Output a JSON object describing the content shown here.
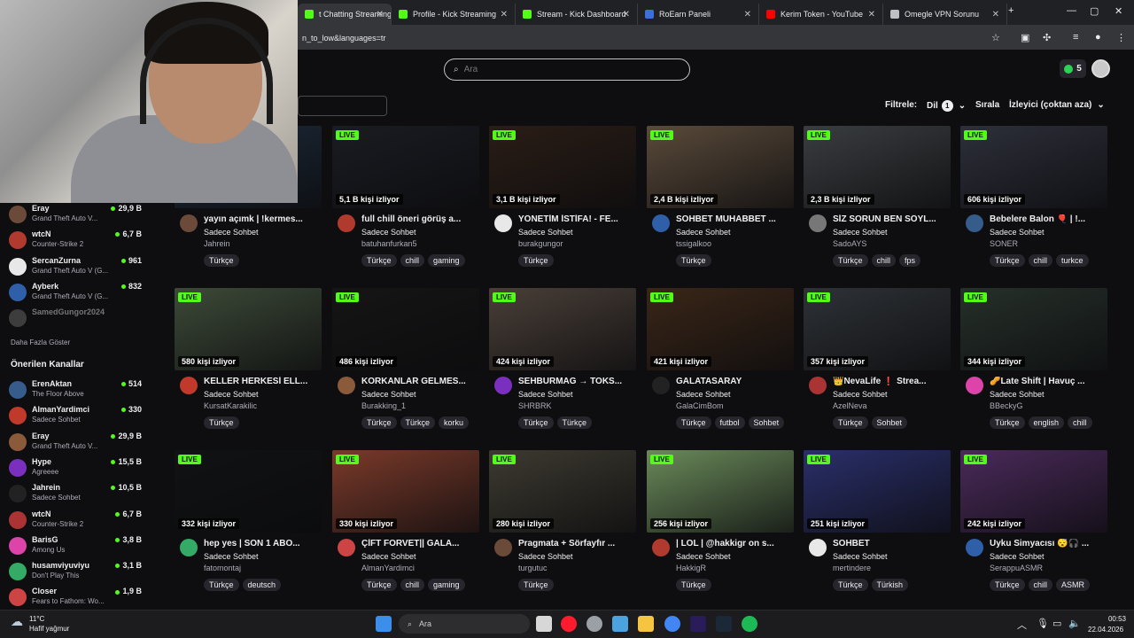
{
  "browser": {
    "tabs": [
      {
        "label": "t Chatting Streaming ·",
        "color": "#53fc18",
        "active": true
      },
      {
        "label": "Profile - Kick Streaming",
        "color": "#53fc18"
      },
      {
        "label": "Stream - Kick Dashboard",
        "color": "#53fc18"
      },
      {
        "label": "RoEarn Paneli",
        "color": "#3d6fd8"
      },
      {
        "label": "Kerim Token - YouTube",
        "color": "#ff0000"
      },
      {
        "label": "Omegle VPN Sorunu",
        "color": "#bdc1c6"
      }
    ],
    "url": "n_to_low&languages=tr"
  },
  "header": {
    "search_placeholder": "Ara",
    "coins": "5"
  },
  "filters": {
    "filter_label": "Filtrele:",
    "language_label": "Dil",
    "language_count": "1",
    "sort_label": "Sırala",
    "sort_value": "İzleyici (çoktan aza)"
  },
  "sidebar": {
    "followed": [
      {
        "name": "Eray",
        "game": "Grand Theft Auto V...",
        "viewers": "29,9 B"
      },
      {
        "name": "wtcN",
        "game": "Counter-Strike 2",
        "viewers": "6,7 B"
      },
      {
        "name": "SercanZurna",
        "game": "Grand Theft Auto V (G...",
        "viewers": "961"
      },
      {
        "name": "Ayberk",
        "game": "Grand Theft Auto V (G...",
        "viewers": "832"
      },
      {
        "name": "SamedGungor2024",
        "game": "",
        "viewers": ""
      }
    ],
    "show_more": "Daha Fazla Göster",
    "recommended_title": "Önerilen Kanallar",
    "recommended": [
      {
        "name": "ErenAktan",
        "game": "The Floor Above",
        "viewers": "514"
      },
      {
        "name": "AlmanYardimci",
        "game": "Sadece Sohbet",
        "viewers": "330"
      },
      {
        "name": "Eray",
        "game": "Grand Theft Auto V...",
        "viewers": "29,9 B"
      },
      {
        "name": "Hype",
        "game": "Agreeee",
        "viewers": "15,5 B"
      },
      {
        "name": "Jahrein",
        "game": "Sadece Sohbet",
        "viewers": "10,5 B"
      },
      {
        "name": "wtcN",
        "game": "Counter-Strike 2",
        "viewers": "6,7 B"
      },
      {
        "name": "BarisG",
        "game": "Among Us",
        "viewers": "3,8 B"
      },
      {
        "name": "husamviyuviyu",
        "game": "Don't Play This",
        "viewers": "3,1 B"
      },
      {
        "name": "Closer",
        "game": "Fears to Fathom: Wo...",
        "viewers": "1,9 B"
      }
    ]
  },
  "live_label": "LIVE",
  "streams": [
    {
      "viewers": "",
      "title": "yayın açımk | !kermes...",
      "category": "Sadece Sohbet",
      "channel": "Jahrein",
      "tags": [
        "Türkçe"
      ],
      "live": false,
      "color": "#1d2a3a"
    },
    {
      "viewers": "5,1 B kişi izliyor",
      "title": "full chill öneri görüş a...",
      "category": "Sadece Sohbet",
      "channel": "batuhanfurkan5",
      "tags": [
        "Türkçe",
        "chill",
        "gaming"
      ],
      "color": "#1a1c22"
    },
    {
      "viewers": "3,1 B kişi izliyor",
      "title": "YÖNETİM İSTİFA! - FE...",
      "category": "Sadece Sohbet",
      "channel": "burakgungor",
      "tags": [
        "Türkçe"
      ],
      "color": "#2a1d16"
    },
    {
      "viewers": "2,4 B kişi izliyor",
      "title": "SOHBET MUHABBET ...",
      "category": "Sadece Sohbet",
      "channel": "tssigalkoo",
      "tags": [
        "Türkçe"
      ],
      "color": "#5a4a3a"
    },
    {
      "viewers": "2,3 B kişi izliyor",
      "title": "SİZ SORUN BEN SÖYL...",
      "category": "Sadece Sohbet",
      "channel": "SadoAYS",
      "tags": [
        "Türkçe",
        "chill",
        "fps"
      ],
      "color": "#3a3d40"
    },
    {
      "viewers": "606 kişi izliyor",
      "title": "Bebelere Balon 🎈 | !...",
      "category": "Sadece Sohbet",
      "channel": "SONER",
      "tags": [
        "Türkçe",
        "chill",
        "turkce"
      ],
      "color": "#2d2f3a"
    },
    {
      "viewers": "580 kişi izliyor",
      "title": "KELLER HERKESİ ELL...",
      "category": "Sadece Sohbet",
      "channel": "KursatKarakilic",
      "tags": [
        "Türkçe"
      ],
      "color": "#3d4a38"
    },
    {
      "viewers": "486 kişi izliyor",
      "title": "KORKANLAR GELMES...",
      "category": "Sadece Sohbet",
      "channel": "Burakking_1",
      "tags": [
        "Türkçe",
        "Türkçe",
        "korku"
      ],
      "color": "#151515"
    },
    {
      "viewers": "424 kişi izliyor",
      "title": "SEHBURMAG → TOKS...",
      "category": "Sadece Sohbet",
      "channel": "SHRBRK",
      "tags": [
        "Türkçe",
        "Türkçe"
      ],
      "color": "#4a3f38"
    },
    {
      "viewers": "421 kişi izliyor",
      "title": "GALATASARAY",
      "category": "Sadece Sohbet",
      "channel": "GalaCimBom",
      "tags": [
        "Türkçe",
        "futbol",
        "Sohbet"
      ],
      "color": "#3a2618"
    },
    {
      "viewers": "357 kişi izliyor",
      "title": "👑NevaLife ❗ Strea...",
      "category": "Sadece Sohbet",
      "channel": "AzelNeva",
      "tags": [
        "Türkçe",
        "Sohbet"
      ],
      "color": "#2e3236"
    },
    {
      "viewers": "344 kişi izliyor",
      "title": "🥜Late Shift | Havuç ...",
      "category": "Sadece Sohbet",
      "channel": "BBeckyG",
      "tags": [
        "Türkçe",
        "english",
        "chill"
      ],
      "color": "#26302a"
    },
    {
      "viewers": "332 kişi izliyor",
      "title": "hep yes | SON 1 ABO...",
      "category": "Sadece Sohbet",
      "channel": "fatomontaj",
      "tags": [
        "Türkçe",
        "deutsch"
      ],
      "color": "#101214"
    },
    {
      "viewers": "330 kişi izliyor",
      "title": "ÇİFT FORVET|| GALA...",
      "category": "Sadece Sohbet",
      "channel": "AlmanYardimci",
      "tags": [
        "Türkçe",
        "chill",
        "gaming"
      ],
      "color": "#7a3a2a"
    },
    {
      "viewers": "280 kişi izliyor",
      "title": "Pragmata + Sörfayfır ...",
      "category": "Sadece Sohbet",
      "channel": "turgutuc",
      "tags": [
        "Türkçe"
      ],
      "color": "#3d3a30"
    },
    {
      "viewers": "256 kişi izliyor",
      "title": "| LOL | @hakkigr on s...",
      "category": "Sadece Sohbet",
      "channel": "HakkigR",
      "tags": [
        "Türkçe"
      ],
      "color": "#6a8a5a"
    },
    {
      "viewers": "251 kişi izliyor",
      "title": "SOHBET",
      "category": "Sadece Sohbet",
      "channel": "mertindere",
      "tags": [
        "Türkçe",
        "Türkish"
      ],
      "color": "#2a2f6a"
    },
    {
      "viewers": "242 kişi izliyor",
      "title": "Uyku Simyacısı 😴🎧 ...",
      "category": "Sadece Sohbet",
      "channel": "SerappuASMR",
      "tags": [
        "Türkçe",
        "chill",
        "ASMR"
      ],
      "color": "#4a2a5a"
    }
  ],
  "taskbar": {
    "temperature": "11°C",
    "condition": "Hafif yağmur",
    "search_placeholder": "Ara",
    "time": "00:53",
    "date": "22.04.2026"
  }
}
